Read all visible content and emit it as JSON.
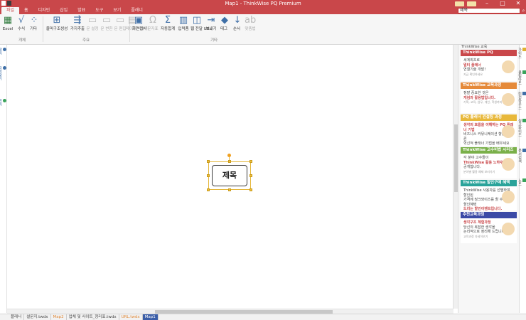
{
  "window": {
    "title": "Map1 - ThinkWise PQ Premium"
  },
  "ribbon_tabs": [
    "파일",
    "홈",
    "디자인",
    "삽입",
    "발표",
    "도구",
    "보기",
    "플래너"
  ],
  "search": {
    "value": "제목"
  },
  "ribbon": {
    "buttons": [
      {
        "id": "excel",
        "label": "Excel",
        "icon": "excel-icon",
        "enabled": true
      },
      {
        "id": "formula",
        "label": "수식",
        "icon": "formula-icon",
        "enabled": true
      },
      {
        "id": "other",
        "label": "기타",
        "icon": "other-icon",
        "enabled": true
      },
      {
        "id": "outline",
        "label": "줄머구조생성",
        "icon": "outline-icon",
        "enabled": true
      },
      {
        "id": "branch",
        "label": "가지추출",
        "icon": "branch-icon",
        "enabled": true
      },
      {
        "id": "file1",
        "label": "문 설정",
        "icon": "doc-icon",
        "enabled": false
      },
      {
        "id": "file2",
        "label": "문 변환",
        "icon": "doc-icon",
        "enabled": false
      },
      {
        "id": "file3",
        "label": "문 편집",
        "icon": "doc-icon",
        "enabled": false
      },
      {
        "id": "file4",
        "label": "페이지 나누기",
        "icon": "page-icon",
        "enabled": false
      },
      {
        "id": "screen",
        "label": "화면캡처",
        "icon": "screen-icon",
        "enabled": true
      },
      {
        "id": "symbol",
        "label": "문자표",
        "icon": "omega-icon",
        "enabled": false
      },
      {
        "id": "autosum",
        "label": "자동합계",
        "icon": "sigma-icon",
        "enabled": true
      },
      {
        "id": "input",
        "label": "입력폼",
        "icon": "input-icon",
        "enabled": true
      },
      {
        "id": "weburl",
        "label": "웹 전달 URL",
        "icon": "web-icon",
        "enabled": true
      },
      {
        "id": "send",
        "label": "보내기",
        "icon": "send-icon",
        "enabled": true
      },
      {
        "id": "tag",
        "label": "태그",
        "icon": "tag-icon",
        "enabled": true
      },
      {
        "id": "order",
        "label": "순서",
        "icon": "order-icon",
        "enabled": true
      },
      {
        "id": "spell",
        "label": "맞춤법",
        "icon": "spell-icon",
        "enabled": false
      }
    ],
    "group_labels": {
      "g1": "개체",
      "g2": "주요",
      "g3": "기타"
    }
  },
  "left_strip": [
    {
      "label": "정리",
      "color": "#3f6fa7"
    },
    {
      "label": "자료찾기",
      "color": "#3f6fa7"
    },
    {
      "label": "관리",
      "color": "#3aa35b"
    }
  ],
  "canvas": {
    "central_topic": "제목"
  },
  "right_panel": {
    "title": "ThinkWise 교육",
    "cards": [
      {
        "header": "ThinkWise PQ",
        "color": "#c9474a",
        "lines": [
          "세계최초로",
          "멀티 플래너",
          "연결기술 개발!"
        ],
        "highlight_index": 1,
        "small": "지금 확인하세요"
      },
      {
        "header": "ThinkWise 교육과정",
        "color": "#e58a3a",
        "lines": [
          "정말 중요한 것은",
          "개념과 활용법입니다."
        ],
        "highlight_index": 1,
        "small": "기획, 교육, 업무, 개인, 학생까지 활용하기"
      },
      {
        "header": "PQ 플래너 컨설팅 과정",
        "color": "#e8b83a",
        "lines": [
          "생각의 흐름을 이해하는 PQ 플래너 기법",
          "비즈니스 커뮤니케이션 향상에 따른",
          "혁신적 플래너 기법을 배우세요"
        ],
        "highlight_index": 0,
        "small": ""
      },
      {
        "header": "ThinkWise 고수비법 시리즈",
        "color": "#7ab04a",
        "lines": [
          "각 분야 고수들이",
          "ThinkWise 활용 노하우를",
          "공개합니다."
        ],
        "highlight_index": 1,
        "small": "분야별 활용 예제 보러가기"
      },
      {
        "header": "ThinkWise 할인구매 혜택",
        "color": "#2aa39a",
        "lines": [
          "ThinkWise 사용자를 선별하여 할인된",
          "가격에 씽크와이즈를 할 수 있는 할인혜택",
          "드리는 할인이벤트입니다."
        ],
        "highlight_index": 2,
        "small": "자세히 확인하세요"
      },
      {
        "header": "추천교육과정",
        "color": "#3b4aa6",
        "lines": [
          "생각구조 체험과정",
          "당신의 복잡한 생각을",
          "논리적으로 정리해 드립니다."
        ],
        "highlight_index": 0,
        "small": "교육과정 자세히보기"
      }
    ]
  },
  "right_tabs": [
    {
      "label": "가이드",
      "color": "#e0b030"
    },
    {
      "label": "클립아트",
      "color": "#3aa35b"
    },
    {
      "label": "비전하우스",
      "color": "#3f6fa7"
    },
    {
      "label": "씽크와이즈",
      "color": "#3aa35b"
    },
    {
      "label": "문서검색",
      "color": "#3f6fa7"
    },
    {
      "label": "노트",
      "color": "#3aa35b"
    }
  ],
  "doc_tabs": [
    {
      "label": "플래너",
      "style": "normal"
    },
    {
      "label": "설문지.twdx",
      "style": "normal"
    },
    {
      "label": "Map2",
      "style": "orange"
    },
    {
      "label": "업체 및 사이트_정리표.twdx",
      "style": "normal"
    },
    {
      "label": "URL.twdx",
      "style": "orange"
    },
    {
      "label": "Map1",
      "style": "active"
    }
  ]
}
